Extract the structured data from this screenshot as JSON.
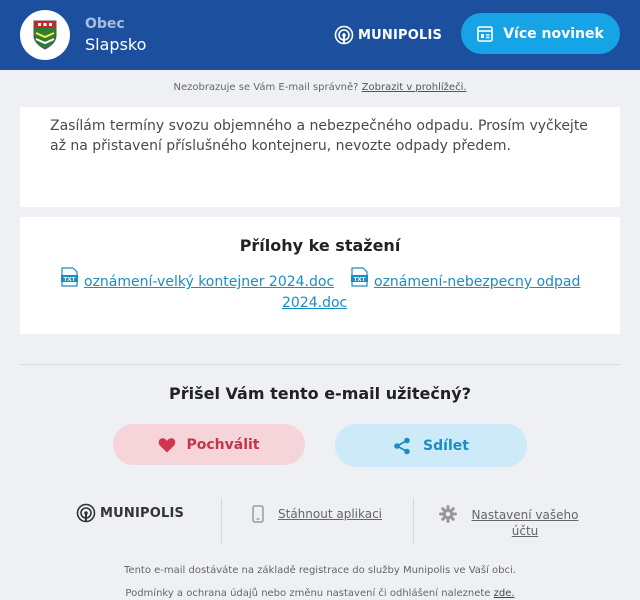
{
  "header": {
    "org_label": "Obec",
    "org_name": "Slapsko",
    "brand": "MUNIPOLIS",
    "more_news_label": "Více novinek",
    "colors": {
      "background": "#1d4f9f",
      "button": "#16a4e6"
    }
  },
  "notice": {
    "text": "Nezobrazuje se Vám E-mail správně?",
    "link": "Zobrazit v prohlížeči."
  },
  "body_text": "Zasílám termíny svozu objemného a nebezpečného odpadu. Prosím vyčkejte až na přistavení příslušného kontejneru, nevozte odpady předem.",
  "attachments": {
    "title": "Přílohy ke stažení",
    "files": [
      {
        "line1": "oznámení-velký kontejner 2024.doc",
        "icon": "txt-file-icon"
      },
      {
        "line1": "oznámení-nebezpecny odpad",
        "line2": "2024.doc",
        "icon": "txt-file-icon"
      }
    ]
  },
  "feedback": {
    "question": "Přišel Vám tento e-mail užitečný?",
    "like_label": "Pochválit",
    "share_label": "Sdílet",
    "colors": {
      "like": "#c8334a",
      "share": "#1a8dc3"
    }
  },
  "footer": {
    "brand": "MUNIPOLIS",
    "app_link": "Stáhnout aplikaci",
    "settings_link_line1": "Nastavení vašeho",
    "settings_link_line2": "účtu",
    "line1": "Tento e-mail dostáváte na základě registrace do služby Munipolis ve Vaší obci.",
    "line2_text": "Podmínky a ochrana údajů nebo změnu nastavení či odhlášení naleznete",
    "line2_link": "zde."
  }
}
